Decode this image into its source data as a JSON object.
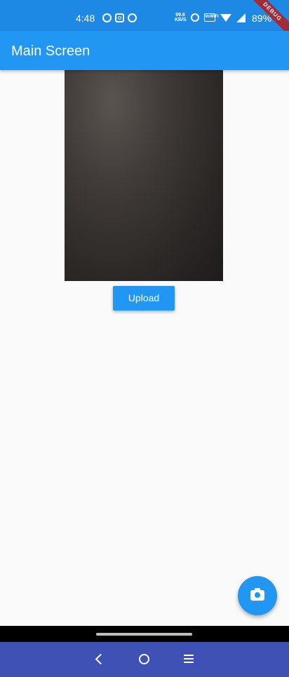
{
  "status_bar": {
    "time": "4:48",
    "net_speed": "99.6 KB/S",
    "vowifi_label": "VoWiFi",
    "battery": "89%",
    "debug_banner": "DEBUG",
    "left_icons": [
      "spotify-icon",
      "instagram-icon",
      "sync-icon"
    ],
    "right_icons": [
      "alarm-icon",
      "vowifi-icon",
      "wifi-icon",
      "signal-icon"
    ]
  },
  "app_bar": {
    "title": "Main Screen"
  },
  "main": {
    "upload_label": "Upload"
  },
  "fab": {
    "icon": "camera-icon"
  },
  "nav_bar": {
    "icons": [
      "back-icon",
      "home-icon",
      "menu-icon"
    ]
  },
  "colors": {
    "primary": "#2196f3",
    "status_bar": "#1e88e5",
    "nav_bar": "#3f51b5",
    "background": "#fafafa"
  }
}
